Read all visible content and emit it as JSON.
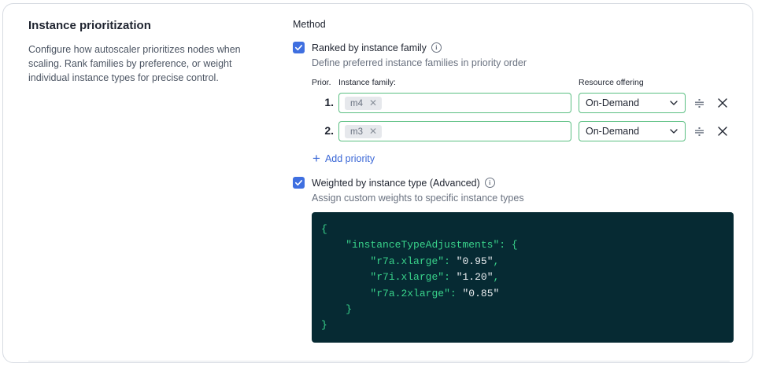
{
  "section": {
    "title": "Instance prioritization",
    "description": "Configure how autoscaler prioritizes nodes when scaling. Rank families by preference, or weight individual instance types for precise control."
  },
  "method": {
    "label": "Method",
    "ranked": {
      "label": "Ranked by instance family",
      "sublabel": "Define preferred instance families in priority order",
      "checked": true
    },
    "table": {
      "col_prior": "Prior.",
      "col_family": "Instance family:",
      "col_offering": "Resource offering",
      "rows": [
        {
          "num": "1.",
          "family_chip": "m4",
          "offering": "On-Demand"
        },
        {
          "num": "2.",
          "family_chip": "m3",
          "offering": "On-Demand"
        }
      ]
    },
    "add_priority_label": "Add priority",
    "weighted": {
      "label": "Weighted by instance type (Advanced)",
      "sublabel": "Assign custom weights to specific instance types",
      "checked": true
    },
    "code": {
      "root_key": "instanceTypeAdjustments",
      "entries": [
        {
          "key": "r7a.xlarge",
          "value": "0.95"
        },
        {
          "key": "r7i.xlarge",
          "value": "1.20"
        },
        {
          "key": "r7a.2xlarge",
          "value": "0.85"
        }
      ]
    }
  },
  "colors": {
    "accent": "#3f6fe0",
    "link": "#3a67d6",
    "input_border": "#5bbf82",
    "code_bg": "#062a33",
    "code_key": "#39d38b"
  },
  "icons": {
    "checkbox": "check-icon",
    "info": "info-icon",
    "chip_remove": "close-icon",
    "select": "chevron-down-icon",
    "reorder": "drag-handle-icon",
    "remove_row": "close-icon",
    "add": "plus-icon"
  }
}
